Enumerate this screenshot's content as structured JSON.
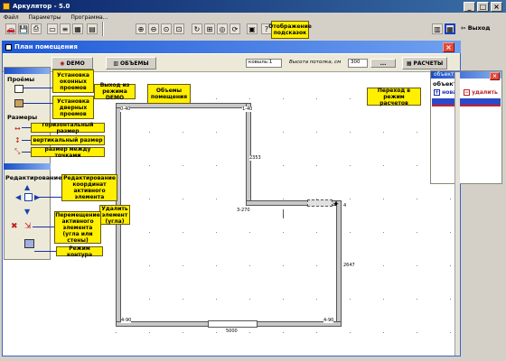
{
  "app": {
    "title": "Аркулятор - 5.0",
    "menu": [
      "Файл",
      "Параметры",
      "Программа..."
    ]
  },
  "toolbar": {
    "exit_label": "Выход",
    "hint_callout": "Отображение подсказок"
  },
  "plan_window": {
    "title": "План помещения"
  },
  "top_bar": {
    "demo_label": "DEMO",
    "objects_label": "ОБЪЕМЫ",
    "level_field": "ковыль:1",
    "ceiling_label": "Высота потолка, см",
    "ceiling_value": "300",
    "ellipsis": "...",
    "calc_label": "РАСЧЕТЫ"
  },
  "left_panel": {
    "openings_title": "Проёмы",
    "sizes_title": "Размеры",
    "editing_title": "Редактирование"
  },
  "callouts": {
    "window_openings": "Установка оконных проемов",
    "door_openings": "Установка дверных проемов",
    "demo_mode": "Выход из режима DEMO",
    "room_volumes": "Объемы помещения",
    "calc_mode": "Переход в режим расчетов",
    "horizontal_size": "горизонтальный размер",
    "vertical_size": "вертикальный размер",
    "point_size": "размер между точками",
    "edit_coords": "Редактирование координат активного элемента",
    "remove_element": "Удалить элемент (угла)",
    "move_element": "Перемещение активного элемента (угла или стены)",
    "outline_mode": "Режим контура"
  },
  "objects_panel": {
    "title": "объект",
    "header": "объект",
    "new_label": "новая",
    "delete_label": "удалить"
  },
  "dimensions": {
    "top_left": "0-40",
    "top_mid": "1-40",
    "right_upper": "2353",
    "inner_corner": "3-270",
    "corner_right": "4",
    "right_lower": "2647",
    "bottom_left": "4-90",
    "bottom_right": "4-90",
    "bottom": "5000"
  }
}
